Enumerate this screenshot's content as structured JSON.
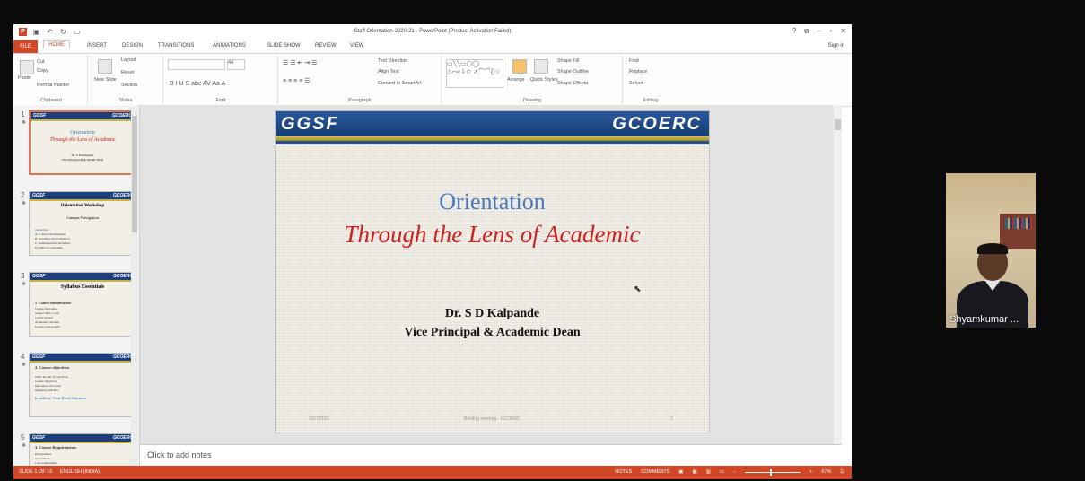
{
  "window": {
    "title": "Staff Orientation-2020-21 - PowerPoint (Product Activation Failed)",
    "sign_in": "Sign in",
    "help": "?",
    "restore": "⧉",
    "minimize": "–",
    "maximize": "▫",
    "close": "✕"
  },
  "tabs": [
    "FILE",
    "HOME",
    "INSERT",
    "DESIGN",
    "TRANSITIONS",
    "ANIMATIONS",
    "SLIDE SHOW",
    "REVIEW",
    "VIEW"
  ],
  "ribbon": {
    "clipboard": {
      "label": "Clipboard",
      "paste": "Paste",
      "cut": "Cut",
      "copy": "Copy",
      "format_painter": "Format Painter"
    },
    "slides": {
      "label": "Slides",
      "new_slide": "New Slide",
      "layout": "Layout",
      "reset": "Reset",
      "section": "Section"
    },
    "font": {
      "label": "Font",
      "size": "44"
    },
    "paragraph": {
      "label": "Paragraph",
      "text_direction": "Text Direction",
      "align_text": "Align Text",
      "smartart": "Convert to SmartArt"
    },
    "drawing": {
      "label": "Drawing",
      "arrange": "Arrange",
      "quick_styles": "Quick Styles",
      "shape_fill": "Shape Fill",
      "shape_outline": "Shape Outline",
      "shape_effects": "Shape Effects"
    },
    "editing": {
      "label": "Editing",
      "find": "Find",
      "replace": "Replace",
      "select": "Select"
    }
  },
  "thumbnails": [
    {
      "num": "1",
      "title": "Orientation",
      "subtitle": "Through the Lens of Academic",
      "lines": [
        "Dr. S D Kalpande",
        "Vice Principal & Academic Dean"
      ]
    },
    {
      "num": "2",
      "title": "Orientation Workshop",
      "subtitle": "Campus Navigation",
      "lines": [
        "Guidelines",
        "A. Course Development",
        "B. Teaching and Evaluation",
        "C. Administrative Activities",
        "D. Delivery Activities"
      ]
    },
    {
      "num": "3",
      "title": "Syllabus Essentials",
      "subtitle": "",
      "lines": [
        "1. Course identification",
        "Course Outcomes",
        "Subject Title, Code",
        "Credit System",
        "Academic calendar",
        "Course Lesson plan"
      ]
    },
    {
      "num": "4",
      "title": "",
      "subtitle": "2. Course objectives",
      "lines": [
        "Write the list of objectives",
        "Course objectives",
        "Outcomes of Course",
        "Mapping with POs",
        "In addition: Value Based Education"
      ]
    },
    {
      "num": "5",
      "title": "",
      "subtitle": "3. Course Requirements",
      "lines": [
        "Prerequisites",
        "Assessment",
        "Lab requirements"
      ]
    }
  ],
  "slide": {
    "logo_left": "GGSF",
    "logo_right": "GCOERC",
    "title": "Orientation",
    "subtitle": "Through the Lens of Academic",
    "presenter": "Dr. S D Kalpande",
    "role": "Vice Principal & Academic Dean",
    "footer_date": "5/27/2021",
    "footer_center": "Briefing meeting - GCOERC",
    "footer_page": "1"
  },
  "notes_placeholder": "Click to add notes",
  "status": {
    "slide_count": "SLIDE 1 OF 15",
    "language": "ENGLISH (INDIA)",
    "notes": "NOTES",
    "comments": "COMMENTS",
    "zoom": "67%"
  },
  "video": {
    "participant_name": "Shyamkumar ..."
  }
}
